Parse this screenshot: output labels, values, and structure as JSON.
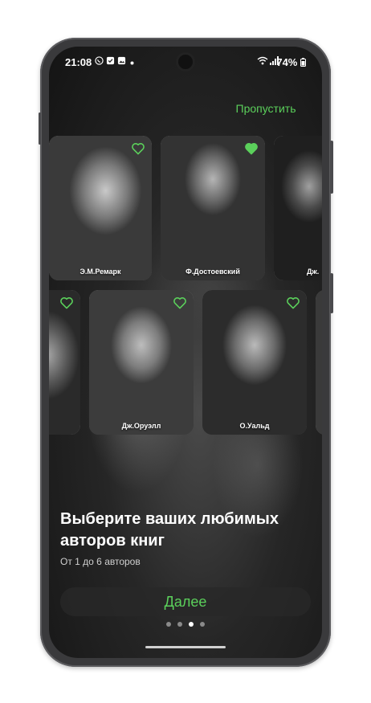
{
  "status_bar": {
    "time": "21:08",
    "battery": "74%",
    "notification_icons": [
      "whatsapp-icon",
      "check-icon",
      "image-icon",
      "dot-icon"
    ],
    "system_icons": [
      "wifi-icon",
      "signal-icon"
    ]
  },
  "header": {
    "skip_label": "Пропустить"
  },
  "authors_row1": [
    {
      "name": "Э.М.Ремарк",
      "liked": false
    },
    {
      "name": "Ф.Достоевский",
      "liked": true
    },
    {
      "name": "Дж.",
      "liked": false
    }
  ],
  "authors_row2": [
    {
      "name": "",
      "liked": false
    },
    {
      "name": "Дж.Оруэлл",
      "liked": false
    },
    {
      "name": "О.Уальд",
      "liked": false
    }
  ],
  "main": {
    "title": "Выберите ваших любимых авторов книг",
    "subtitle": "От 1 до 6 авторов",
    "next_label": "Далее"
  },
  "pagination": {
    "count": 4,
    "active_index": 2
  },
  "colors": {
    "accent": "#5bd05b",
    "background": "#1f1f1f",
    "text": "#ffffff"
  }
}
